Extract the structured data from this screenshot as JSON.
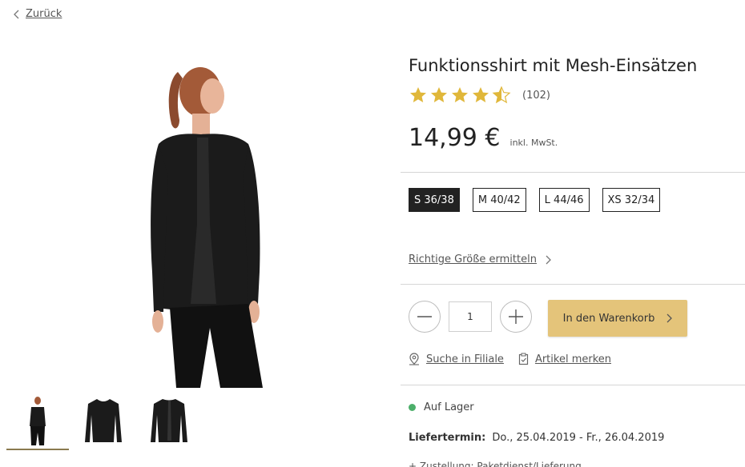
{
  "nav": {
    "back_label": "Zurück"
  },
  "product": {
    "title": "Funktionsshirt mit Mesh-Einsätzen",
    "rating": {
      "value": 4.5,
      "max": 5,
      "count_label": "(102)"
    },
    "price": {
      "value": "14,99 €",
      "tax_note": "inkl. MwSt."
    },
    "sizes": [
      {
        "label": "S 36/38",
        "selected": true
      },
      {
        "label": "M 40/42",
        "selected": false
      },
      {
        "label": "L 44/46",
        "selected": false
      },
      {
        "label": "XS 32/34",
        "selected": false
      }
    ],
    "size_link_label": "Richtige Größe ermitteln",
    "quantity": "1",
    "cart_label": "In den Warenkorb",
    "store_link_label": "Suche in Filiale",
    "wishlist_label": "Artikel merken",
    "stock_label": "Auf Lager",
    "delivery": {
      "key": "Liefertermin:",
      "value": "Do., 25.04.2019 - Fr., 26.04.2019"
    },
    "partial_text": "+ Zustellung: Paketdienst/Lieferung"
  },
  "colors": {
    "accent": "#e4c47a",
    "star": "#e0b73a",
    "in_stock": "#4caf6a",
    "selected_size_bg": "#222222"
  },
  "icons": [
    "chevron-left-icon",
    "star-icon",
    "chevron-right-icon",
    "minus-icon",
    "plus-icon",
    "location-pin-icon",
    "clipboard-check-icon"
  ]
}
